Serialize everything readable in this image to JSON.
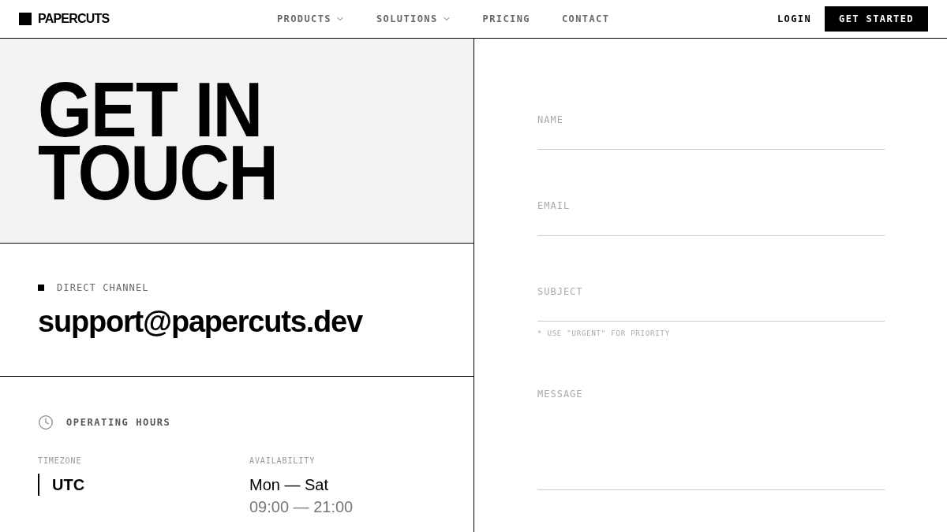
{
  "header": {
    "logo": "PAPERCUTS",
    "nav": [
      {
        "label": "PRODUCTS",
        "dropdown": true
      },
      {
        "label": "SOLUTIONS",
        "dropdown": true
      },
      {
        "label": "PRICING",
        "dropdown": false
      },
      {
        "label": "CONTACT",
        "dropdown": false
      }
    ],
    "login": "LOGIN",
    "cta": "GET STARTED"
  },
  "hero": {
    "title": "GET IN TOUCH"
  },
  "direct_channel": {
    "label": "DIRECT CHANNEL",
    "email": "support@papercuts.dev"
  },
  "hours": {
    "title": "OPERATING HOURS",
    "timezone": {
      "label": "TIMEZONE",
      "value": "UTC"
    },
    "availability": {
      "label": "AVAILABILITY",
      "days": "Mon — Sat",
      "time": "09:00 — 21:00"
    }
  },
  "form": {
    "fields": [
      {
        "kind": "input",
        "placeholder": "NAME"
      },
      {
        "kind": "input",
        "placeholder": "EMAIL"
      },
      {
        "kind": "input",
        "placeholder": "SUBJECT",
        "hint": "* USE \"URGENT\" FOR PRIORITY"
      },
      {
        "kind": "textarea",
        "placeholder": "MESSAGE"
      }
    ]
  }
}
